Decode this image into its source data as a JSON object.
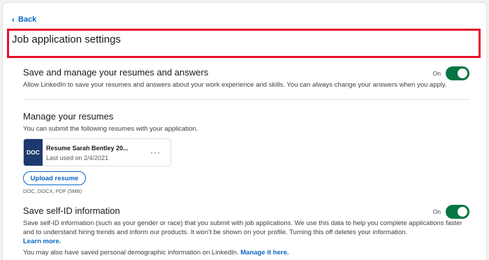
{
  "nav": {
    "back_label": "Back"
  },
  "page": {
    "title": "Job application settings"
  },
  "save_section": {
    "title": "Save and manage your resumes and answers",
    "description": "Allow LinkedIn to save your resumes and answers about your work experience and skills. You can always change your answers when you apply.",
    "toggle_label": "On",
    "toggle_on": true
  },
  "resumes_section": {
    "title": "Manage your resumes",
    "description": "You can submit the following resumes with your application.",
    "resumes": [
      {
        "badge": "DOC",
        "name": "Resume Sarah Bentley 20...",
        "last_used": "Last used on 2/4/2021",
        "more": "···"
      }
    ],
    "upload_label": "Upload resume",
    "formats": "DOC, DOCX, PDF (5MB)"
  },
  "selfid_section": {
    "title": "Save self-ID information",
    "description": "Save self-ID information (such as your gender or race) that you submit with job applications. We use this data to help you complete applications faster and to understand hiring trends and inform our products. It won’t be shown on your profile. Turning this off deletes your information.",
    "learn_more": "Learn more.",
    "note": "You may also have saved personal demographic information on LinkedIn.",
    "manage_link": "Manage it here.",
    "toggle_label": "On",
    "toggle_on": true
  },
  "colors": {
    "accent": "#0a66c2",
    "toggle_on": "#057642",
    "highlight": "#e8102c",
    "doc_badge": "#1c3a6e"
  },
  "icons": {
    "back": "chevron-left-icon",
    "more": "more-horizontal-icon"
  }
}
